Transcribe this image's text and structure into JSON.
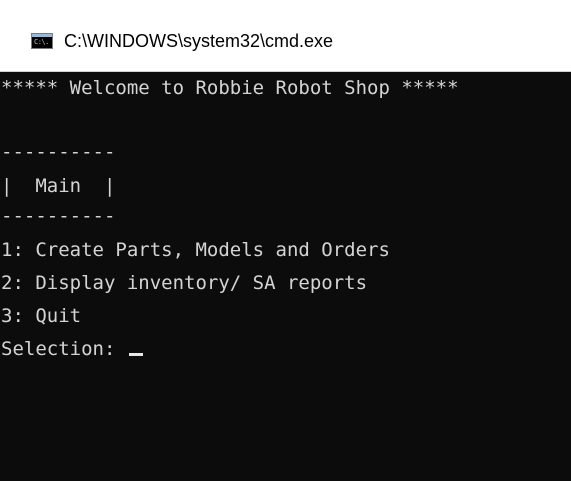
{
  "window": {
    "title": "C:\\WINDOWS\\system32\\cmd.exe",
    "icon": "console-icon",
    "icon_glyph": "C:\\."
  },
  "console": {
    "background_color": "#0c0c0c",
    "text_color": "#d4d4d4",
    "lines": {
      "welcome": "***** Welcome to Robbie Robot Shop *****",
      "blank1": "",
      "separator_top": "----------",
      "menu_title": "|  Main  |",
      "separator_bottom": "----------",
      "option1": "1: Create Parts, Models and Orders",
      "option2": "2: Display inventory/ SA reports",
      "option3": "3: Quit",
      "prompt": "Selection: "
    }
  }
}
